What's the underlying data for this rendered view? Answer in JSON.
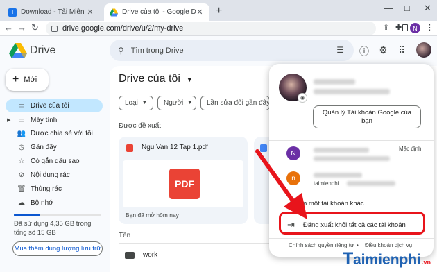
{
  "browser": {
    "tabs": [
      {
        "title": "Download - Tải Miễn Phí VN - Ph",
        "favicon": "T",
        "active": false
      },
      {
        "title": "Drive của tôi - Google Drive",
        "favicon": "drive",
        "active": true
      }
    ],
    "url": "drive.google.com/drive/u/2/my-drive",
    "profile_initial": "N",
    "window_controls": [
      "—",
      "□",
      "✕"
    ]
  },
  "app": {
    "name": "Drive",
    "search_placeholder": "Tìm trong Drive"
  },
  "sidebar": {
    "new_label": "Mới",
    "items": [
      {
        "label": "Drive của tôi",
        "icon": "drive-icon",
        "active": true
      },
      {
        "label": "Máy tính",
        "icon": "computer-icon",
        "active": false
      },
      {
        "label": "Được chia sẻ với tôi",
        "icon": "shared-icon",
        "active": false
      },
      {
        "label": "Gần đây",
        "icon": "clock-icon",
        "active": false
      },
      {
        "label": "Có gắn dấu sao",
        "icon": "star-icon",
        "active": false
      },
      {
        "label": "Nội dung rác",
        "icon": "spam-icon",
        "active": false
      },
      {
        "label": "Thùng rác",
        "icon": "trash-icon",
        "active": false
      },
      {
        "label": "Bộ nhớ",
        "icon": "cloud-icon",
        "active": false
      }
    ],
    "storage_text": "Đã sử dụng 4,35 GB trong tổng số 15 GB",
    "storage_fraction": 0.29,
    "buy_label": "Mua thêm dung lượng lưu trữ"
  },
  "main": {
    "title": "Drive của tôi",
    "filters": [
      "Loại",
      "Người",
      "Lần sửa đổi gần đây n"
    ],
    "suggested_label": "Được đề xuất",
    "card": {
      "file_name": "Ngu Van 12 Tap 1.pdf",
      "thumb_text": "PDF",
      "opened_text": "Bạn đã mở hôm nay"
    },
    "column_name": "Tên",
    "folder_name": "work"
  },
  "account_menu": {
    "manage_label": "Quản lý Tài khoản Google của bạn",
    "default_label": "Mặc định",
    "account1_initial": "N",
    "account2_initial": "n",
    "account2_email_prefix": "taimienphi",
    "add_account_label": "Thêm một tài khoản khác",
    "signout_label": "Đăng xuất khỏi tất cả các tài khoản",
    "privacy_label": "Chính sách quyền riêng tư",
    "terms_label": "Điều khoản dịch vụ",
    "footer_dot": "•"
  },
  "watermark": {
    "text": "aimienphi",
    "suffix": ".vn",
    "initial": "T"
  },
  "colors": {
    "accent": "#0b57d0",
    "highlight": "#e8141b",
    "active_nav": "#c2e7ff"
  }
}
